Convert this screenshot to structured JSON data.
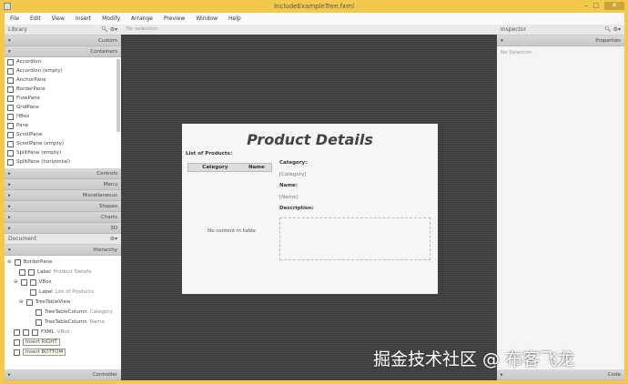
{
  "window": {
    "title": "IncludeExampleTree.fxml"
  },
  "menu": [
    "File",
    "Edit",
    "View",
    "Insert",
    "Modify",
    "Arrange",
    "Preview",
    "Window",
    "Help"
  ],
  "library": {
    "title": "Library",
    "sections_top": [
      "Custom",
      "Containers"
    ],
    "items": [
      "Accordion",
      "Accordion  (empty)",
      "AnchorPane",
      "BorderPane",
      "FlowPane",
      "GridPane",
      "HBox",
      "Pane",
      "ScrollPane",
      "ScrollPane  (empty)",
      "SplitPane  (empty)",
      "SplitPane  (horizontal)"
    ],
    "sections_bottom": [
      "Controls",
      "Menu",
      "Miscellaneous",
      "Shapes",
      "Charts",
      "3D"
    ]
  },
  "document": {
    "title": "Document",
    "hierarchy": "Hierarchy",
    "controller": "Controller",
    "tree": [
      {
        "type": "BorderPane",
        "sub": ""
      },
      {
        "type": "Label",
        "sub": "Product Details"
      },
      {
        "type": "VBox",
        "sub": ""
      },
      {
        "type": "Label",
        "sub": "List of Products"
      },
      {
        "type": "TreeTableView",
        "sub": ""
      },
      {
        "type": "TreeTableColumn",
        "sub": "Category"
      },
      {
        "type": "TreeTableColumn",
        "sub": "Name"
      },
      {
        "type": "FXML",
        "sub": "VBox"
      },
      {
        "type": "Insert RIGHT",
        "sub": ""
      },
      {
        "type": "Insert BOTTOM",
        "sub": ""
      }
    ]
  },
  "canvas": {
    "selection": "No selection",
    "title": "Product Details",
    "list_label": "List of Products:",
    "columns": [
      "Category",
      "Name"
    ],
    "empty": "No content in table",
    "category_label": "Category:",
    "category_value": "[Category]",
    "name_label": "Name:",
    "name_value": "[Name]",
    "description_label": "Description:"
  },
  "inspector": {
    "title": "Inspector",
    "section": "Properties",
    "selection": "No Selection",
    "code": "Code"
  },
  "watermark": "掘金技术社区 @ 布客飞龙"
}
